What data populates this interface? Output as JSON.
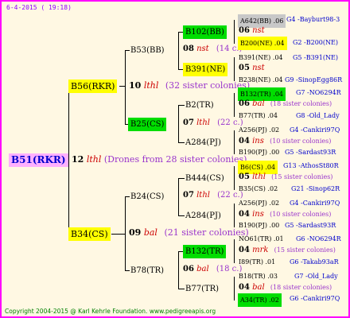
{
  "header": {
    "date": "6-4-2015 ( 19:18)"
  },
  "root": {
    "label": "B51(RKR)"
  },
  "center": {
    "num": "12",
    "breed": "lthl",
    "note": "(Drones from 28 sister colonies)"
  },
  "upper": {
    "node": "B56(RKR)",
    "num": "10",
    "breed": "lthl",
    "note": "(32 sister colonies)",
    "upper": {
      "node": "B53(BB)",
      "num": "08",
      "breed": "nst",
      "note": "(14 c.)",
      "upper": {
        "node": "B102(BB)",
        "num": "06",
        "breed": "nst",
        "lines": [
          {
            "a": "A642(BB) .06",
            "b": "G4 -Bayburt98-3"
          },
          {
            "a": "B200(NE) .04",
            "b": "G2 -B200(NE)"
          }
        ]
      },
      "lower": {
        "node": "B391(NE)",
        "num": "05",
        "breed": "nst",
        "lines": [
          {
            "a": "B391(NE) .04",
            "b": "G5 -B391(NE)"
          },
          {
            "a": "B238(NE) .04",
            "b": "G9 -SinopEgg86R"
          }
        ]
      }
    },
    "lower": {
      "node": "B25(CS)",
      "num": "07",
      "breed": "lthl",
      "note": "(22 c.)",
      "upper": {
        "node": "B2(TR)",
        "num": "06",
        "breed": "bal",
        "note": "(18 sister colonies)",
        "lines": [
          {
            "a": "B132(TR) .04",
            "b": "G7 -NO6294R"
          },
          {
            "a": "B77(TR) .04",
            "b": "G8 -Old_Lady"
          }
        ]
      },
      "lower": {
        "node": "A284(PJ)",
        "num": "04",
        "breed": "ins",
        "note": "(10 sister colonies)",
        "lines": [
          {
            "a": "A256(PJ) .02",
            "b": "G4 -Cankiri97Q"
          },
          {
            "a": "B190(PJ) .00",
            "b": "G5 -Sardast93R"
          }
        ]
      }
    }
  },
  "lower": {
    "node": "B34(CS)",
    "num": "09",
    "breed": "bal",
    "note": "(21 sister colonies)",
    "upper": {
      "node": "B24(CS)",
      "num": "07",
      "breed": "lthl",
      "note": "(22 c.)",
      "upper": {
        "node": "B444(CS)",
        "num": "05",
        "breed": "lthl",
        "note": "(15 sister colonies)",
        "lines": [
          {
            "a": "B6(CS) .04",
            "b": "G13 -AthosSt80R"
          },
          {
            "a": "B35(CS) .02",
            "b": "G21 -Sinop62R"
          }
        ]
      },
      "lower": {
        "node": "A284(PJ)",
        "num": "04",
        "breed": "ins",
        "note": "(10 sister colonies)",
        "lines": [
          {
            "a": "A256(PJ) .02",
            "b": "G4 -Cankiri97Q"
          },
          {
            "a": "B190(PJ) .00",
            "b": "G5 -Sardast93R"
          }
        ]
      }
    },
    "lower": {
      "node": "B78(TR)",
      "num": "06",
      "breed": "bal",
      "note": "(18 c.)",
      "upper": {
        "node": "B132(TR)",
        "num": "04",
        "breed": "mrk",
        "note": "(15 sister colonies)",
        "lines": [
          {
            "a": "NO61(TR) .01",
            "b": "G6 -NO6294R"
          },
          {
            "a": "I89(TR) .01",
            "b": "G6 -Takab93aR"
          }
        ]
      },
      "lower": {
        "node": "B77(TR)",
        "num": "04",
        "breed": "bal",
        "note": "(18 sister colonies)",
        "lines": [
          {
            "a": "B18(TR) .03",
            "b": "G7 -Old_Lady"
          },
          {
            "a": "A34(TR) .02",
            "b": "G6 -Cankiri97Q"
          }
        ]
      }
    }
  },
  "footer": {
    "copyright": "Copyright 2004-2015 @ Karl Kehrle Foundation.  www.pedigreeapis.org"
  }
}
